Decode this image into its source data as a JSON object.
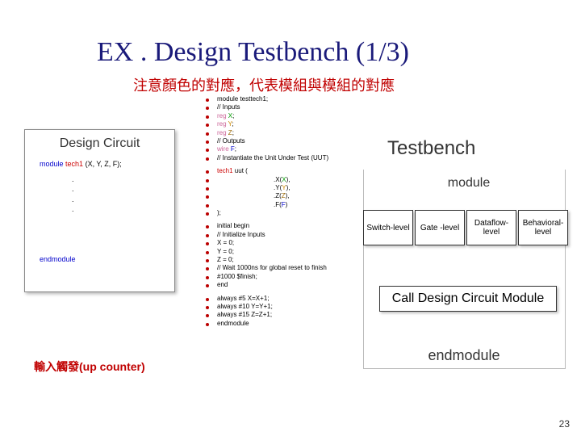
{
  "title": "EX . Design Testbench (1/3)",
  "subtitle": "注意顏色的對應，代表模組與模組的對應",
  "design_circuit": {
    "header": "Design Circuit",
    "module_kw": "module",
    "module_name": "tech1",
    "module_ports": "(X, Y, Z, F);",
    "dots": [
      ".",
      ".",
      ".",
      "."
    ],
    "endmodule": "endmodule"
  },
  "testbench_code": {
    "l01": "module testtech1;",
    "l02": "// Inputs",
    "l03a": "reg",
    "l03b": "X",
    "l03c": ";",
    "l04a": "reg",
    "l04b": "Y",
    "l04c": ";",
    "l05a": "reg",
    "l05b": "Z",
    "l05c": ";",
    "l06": "// Outputs",
    "l07a": "wire",
    "l07b": "F",
    "l07c": ";",
    "l08": "// Instantiate the Unit Under Test (UUT)",
    "l09a": "tech1",
    "l09b": " uut (",
    "l10a": ".X",
    "l10b": "(",
    "l10c": "X",
    "l10d": "),",
    "l11a": ".Y",
    "l11b": "(",
    "l11c": "Y",
    "l11d": "),",
    "l12a": ".Z",
    "l12b": "(",
    "l12c": "Z",
    "l12d": "),",
    "l13a": ".F",
    "l13b": "(",
    "l13c": "F",
    "l13d": ")",
    "l14": ");",
    "l15": "initial begin",
    "l16": "// Initialize Inputs",
    "l17": "X = 0;",
    "l18": "Y = 0;",
    "l19": "Z = 0;",
    "l20": "// Wait 1000ns for global reset to finish",
    "l21": "#1000 $finish;",
    "l22": "end",
    "l23": "always #5 X=X+1;",
    "l24": "always #10 Y=Y+1;",
    "l25": "always #15 Z=Z+1;",
    "l26": "endmodule"
  },
  "labels": {
    "testbench": "Testbench",
    "module": "module",
    "levels": [
      "Switch-level",
      "Gate -level",
      "Dataflow-level",
      "Behavioral-level"
    ],
    "call": "Call Design Circuit Module",
    "endmodule": "endmodule",
    "input_trigger": "輸入觸發(up counter)"
  },
  "page": "23"
}
